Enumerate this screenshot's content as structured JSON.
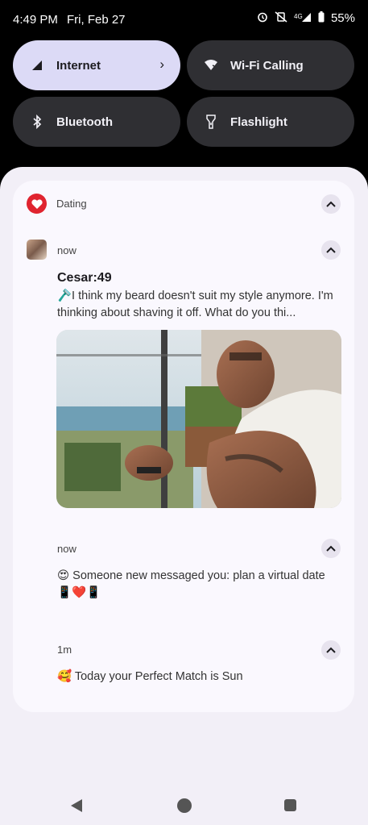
{
  "status": {
    "time": "4:49 PM",
    "date": "Fri, Feb 27",
    "battery": "55%"
  },
  "tiles": [
    {
      "label": "Internet",
      "icon": "signal-icon",
      "active": true
    },
    {
      "label": "Wi-Fi Calling",
      "icon": "wifi-calling-icon",
      "active": false
    },
    {
      "label": "Bluetooth",
      "icon": "bluetooth-icon",
      "active": false
    },
    {
      "label": "Flashlight",
      "icon": "flashlight-icon",
      "active": false
    }
  ],
  "notification": {
    "app_name": "Dating",
    "messages": [
      {
        "time": "now",
        "title": "Cesar:49",
        "text": "🪒I think my beard doesn't suit my style anymore. I'm thinking about shaving it off. What do you thi..."
      },
      {
        "time": "now",
        "text": "😍 Someone new messaged you: plan a virtual date 📱❤️📱"
      },
      {
        "time": "1m",
        "text": "🥰 Today your Perfect Match is Sun"
      }
    ]
  },
  "colors": {
    "accent_tile": "#dcdaf6",
    "app_icon": "#e0242f",
    "shade_bg": "#f2eff7"
  }
}
